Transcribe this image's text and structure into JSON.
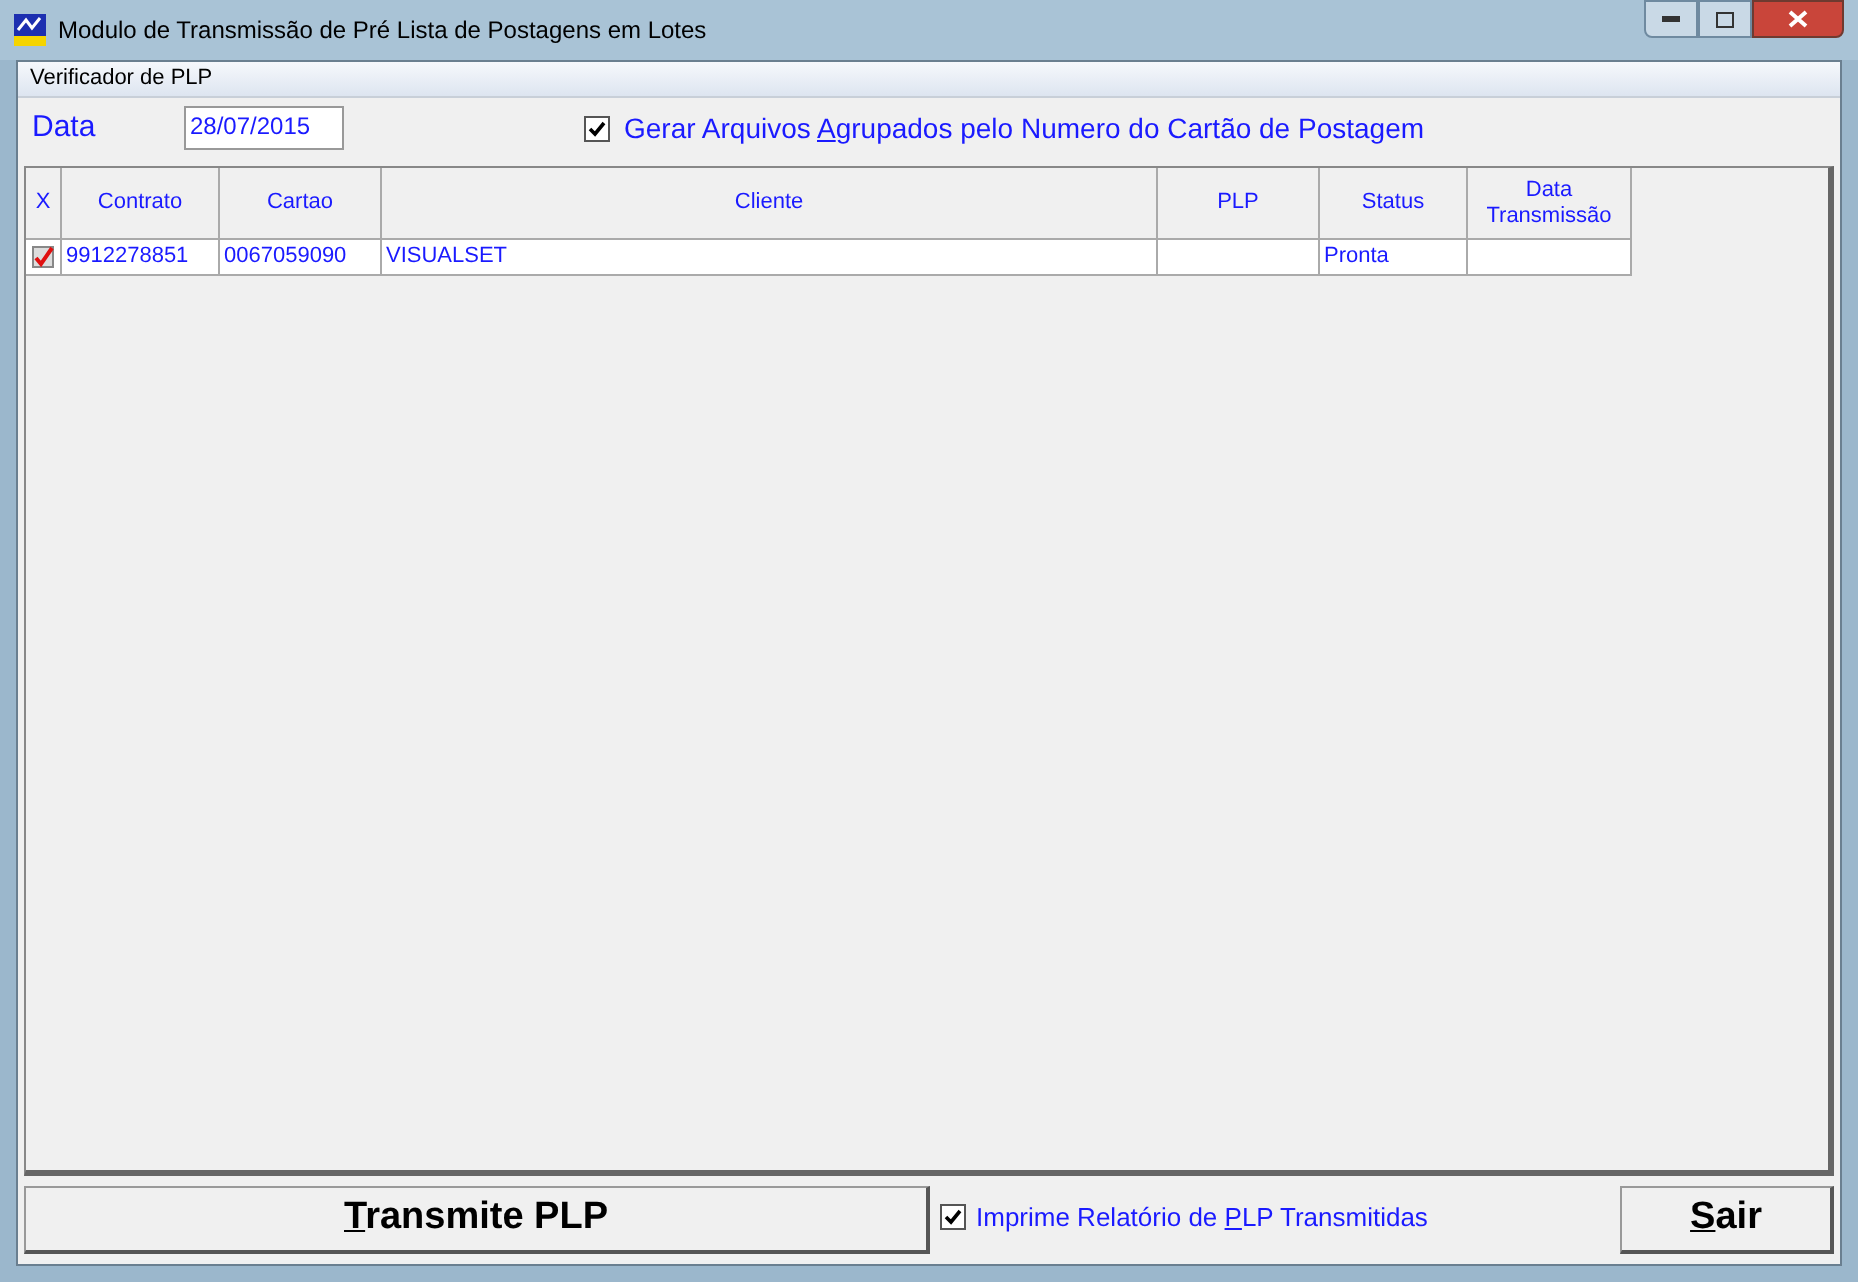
{
  "window": {
    "title": "Modulo de Transmissão de Pré Lista de Postagens em Lotes"
  },
  "menu": [
    "Verificador de PLP"
  ],
  "date_field": {
    "label": "Data",
    "value": "28/07/2015"
  },
  "group_option": {
    "checked": true,
    "label": {
      "before": "Gerar Arquivos ",
      "accel": "A",
      "after": "grupados pelo Numero do Cartão de Postagem"
    }
  },
  "table": {
    "columns": [
      {
        "label": "X",
        "kind": "check"
      },
      {
        "label": "Contrato",
        "kind": "text"
      },
      {
        "label": "Cartao",
        "kind": "text"
      },
      {
        "label": "Cliente",
        "kind": "text"
      },
      {
        "label": "PLP",
        "kind": "text"
      },
      {
        "label": "Status",
        "kind": "text"
      },
      {
        "label": "Data Transmissão",
        "kind": "text"
      }
    ],
    "rows": [
      {
        "checked": true,
        "cells": [
          "",
          "9912278851",
          "0067059090",
          "VISUALSET",
          "",
          "Pronta",
          ""
        ]
      }
    ]
  },
  "transmit_button": {
    "accel": "T",
    "after": "ransmite PLP"
  },
  "print_option": {
    "checked": true,
    "label": {
      "before": "Imprime Relatório de ",
      "accel": "P",
      "after": "LP Transmitidas"
    }
  },
  "exit_button": {
    "accel": "S",
    "after": "air"
  }
}
